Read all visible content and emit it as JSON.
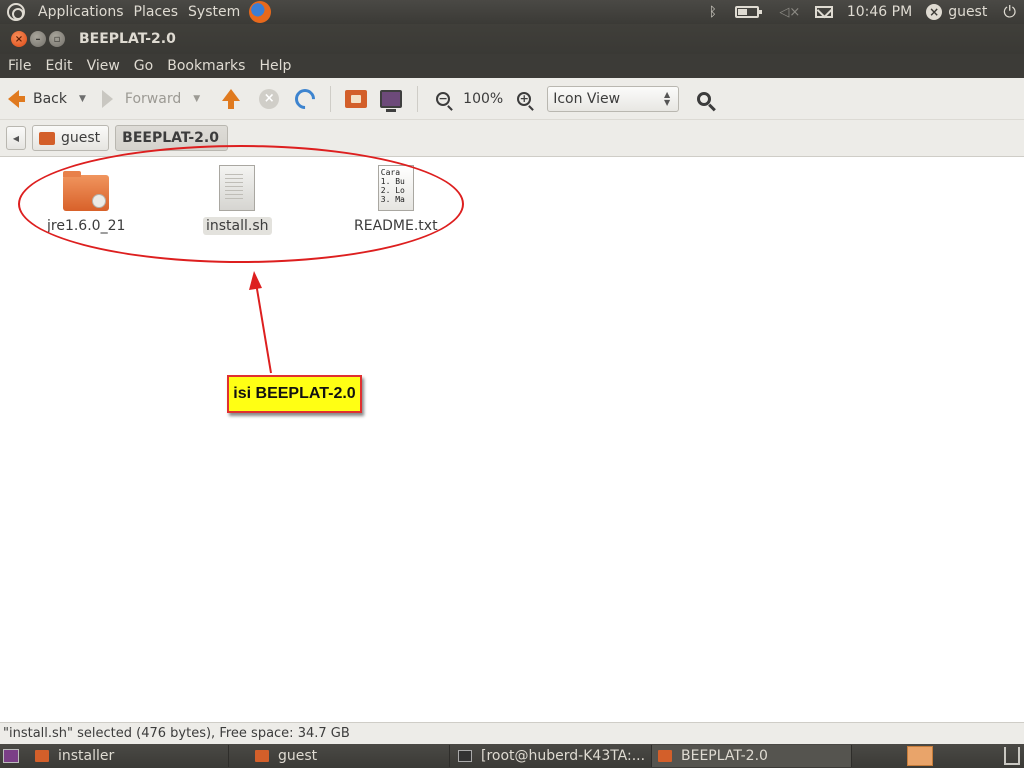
{
  "top_panel": {
    "menus": [
      "Applications",
      "Places",
      "System"
    ],
    "time": "10:46 PM",
    "user": "guest"
  },
  "window": {
    "title": "BEEPLAT-2.0",
    "menubar": [
      "File",
      "Edit",
      "View",
      "Go",
      "Bookmarks",
      "Help"
    ]
  },
  "toolbar": {
    "back_label": "Back",
    "forward_label": "Forward",
    "zoom": "100%",
    "view_mode": "Icon View"
  },
  "pathbar": {
    "crumbs": [
      "guest",
      "BEEPLAT-2.0"
    ]
  },
  "files": [
    {
      "name": "jre1.6.0_21",
      "type": "folder"
    },
    {
      "name": "install.sh",
      "type": "script",
      "selected": true
    },
    {
      "name": "README.txt",
      "type": "text",
      "preview": "Cara\n1. Bu\n2. Lo\n3. Ma"
    }
  ],
  "annotation": {
    "note": "isi BEEPLAT-2.0",
    "color": "#dd1f1f",
    "note_bg": "#ffff14"
  },
  "status": "\"install.sh\" selected (476 bytes), Free space: 34.7 GB",
  "taskbar": {
    "tasks": [
      "installer",
      "guest",
      "[root@huberd-K43TA:...",
      "BEEPLAT-2.0"
    ]
  },
  "colors": {
    "accent": "#dd4814",
    "panel": "#3c3b37"
  }
}
